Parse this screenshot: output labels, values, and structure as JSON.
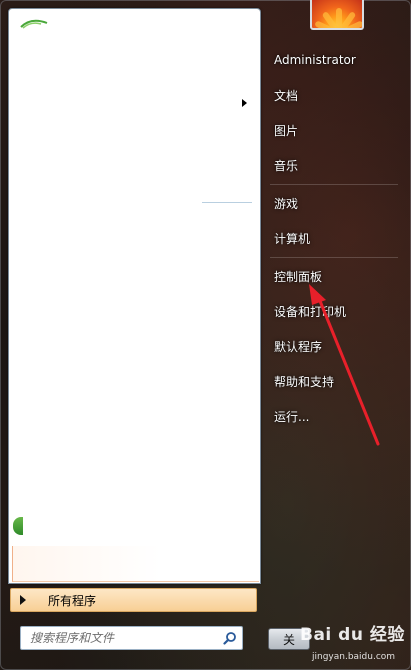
{
  "user": {
    "name": "Administrator"
  },
  "menu": {
    "items": [
      {
        "label": "文档"
      },
      {
        "label": "图片"
      },
      {
        "label": "音乐"
      },
      {
        "label": "游戏"
      },
      {
        "label": "计算机"
      },
      {
        "label": "控制面板"
      },
      {
        "label": "设备和打印机"
      },
      {
        "label": "默认程序"
      },
      {
        "label": "帮助和支持"
      },
      {
        "label": "运行..."
      }
    ]
  },
  "all_programs": {
    "label": "所有程序"
  },
  "search": {
    "placeholder": "搜索程序和文件"
  },
  "shutdown": {
    "label": "关"
  },
  "watermark": {
    "brand": "Bai du 经验",
    "url": "jingyan.baidu.com"
  },
  "colors": {
    "annotation_arrow": "#e8202a",
    "all_programs_highlight": "#f8cf95"
  }
}
